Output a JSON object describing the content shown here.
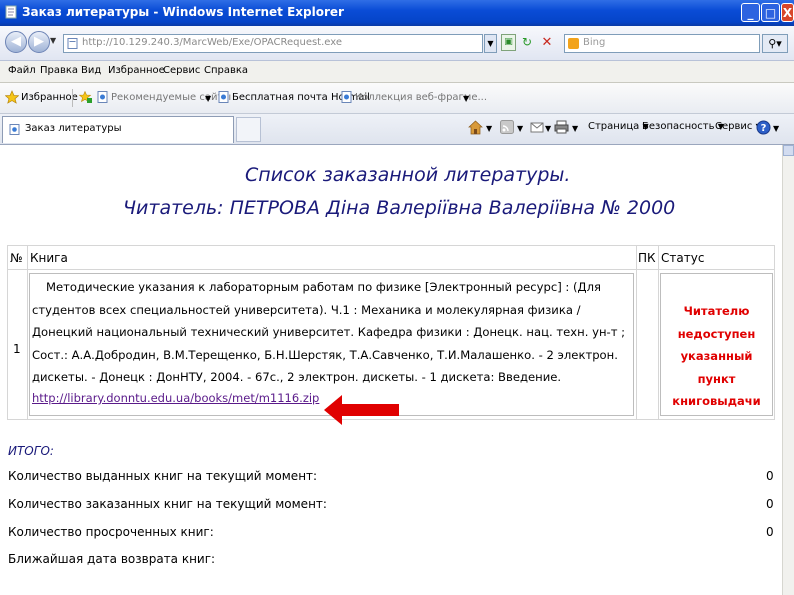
{
  "window": {
    "title": "Заказ литературы - Windows Internet Explorer",
    "controls": [
      "_",
      "□",
      "X"
    ]
  },
  "address": {
    "url": "http://10.129.240.3/MarcWeb/Exe/OPACRequest.exe",
    "search_placeholder": "Bing"
  },
  "menu": [
    "Файл",
    "Правка",
    "Вид",
    "Избранное",
    "Сервис",
    "Справка"
  ],
  "favorites": {
    "label": "Избранное",
    "items": [
      "Рекомендуемые сайты",
      "Бесплатная почта Hotmail",
      "Коллекция веб-фрагме..."
    ]
  },
  "tab": {
    "label": "Заказ литературы"
  },
  "commands": {
    "page": "Страница",
    "safety": "Безопасность",
    "tools": "Сервис"
  },
  "content": {
    "title": "Список заказанной литературы.",
    "reader_line": "Читатель: ПЕТРОВА Діна Валеріївна Валеріївна   № 2000",
    "table": {
      "headers": {
        "num": "№",
        "book": "Книга",
        "pk": "ПК",
        "status": "Статус"
      },
      "rows": [
        {
          "num": "1",
          "description": "Методические указания к лабораторным работам по физике [Электронный ресурс] : (Для студентов всех специальностей университета). Ч.1 : Механика и молекулярная физика / Донецкий национальный технический университет. Кафедра физики : Донецк. нац. техн. ун-т ; Сост.: А.А.Добродин, В.М.Терещенко, Б.Н.Шерстяк, Т.А.Савченко, Т.И.Малашенко. - 2 электрон. дискеты. - Донецк : ДонНТУ, 2004. - 67с., 2 электрон. дискеты. - 1 дискета: Введение.",
          "link": "http://library.donntu.edu.ua/books/met/m1116.zip",
          "pk": "",
          "status": "Читателю недоступен указанный пункт книговыдачи"
        }
      ]
    },
    "summary": {
      "heading": "ИТОГО:",
      "items": [
        {
          "label": "Количество выданных книг на текущий момент:",
          "value": "0"
        },
        {
          "label": "Количество заказанных книг на текущий момент:",
          "value": "0"
        },
        {
          "label": "Количество просроченных книг:",
          "value": "0"
        },
        {
          "label": "Ближайшая дата возврата книг:",
          "value": ""
        }
      ]
    }
  },
  "colors": {
    "title_bar": "#0a4cd6",
    "heading_text": "#1a1a7a",
    "status_text": "#e00000",
    "arrow": "#e00000",
    "link": "#5a1a8a"
  }
}
